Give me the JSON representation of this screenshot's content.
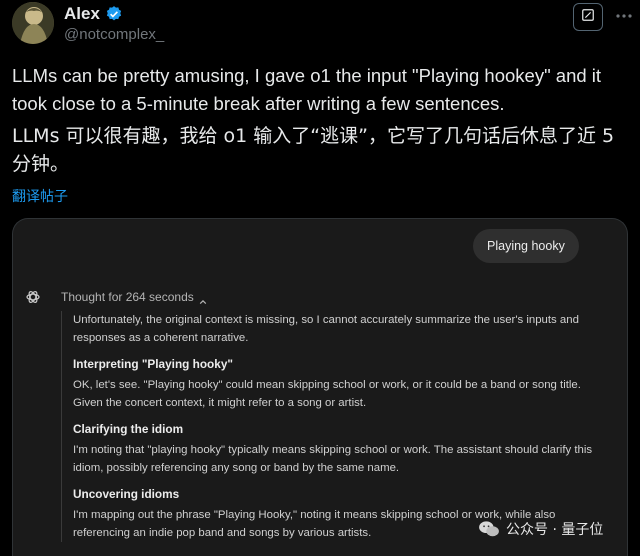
{
  "author": {
    "name": "Alex",
    "handle": "@notcomplex_",
    "verified": true
  },
  "tweet": {
    "text_en": "LLMs can be pretty amusing, I gave o1 the input \"Playing hookey\" and it took close to a 5-minute break after writing a few sentences.",
    "text_zh": "LLMs 可以很有趣，我给 o1 输入了“逃课”，它写了几句话后休息了近 5 分钟。",
    "translate_link": "翻译帖子"
  },
  "chat": {
    "user_message": "Playing hooky",
    "thought_label": "Thought for 264 seconds",
    "intro": "Unfortunately, the original context is missing, so I cannot accurately summarize the user's inputs and responses as a coherent narrative.",
    "steps": [
      {
        "title": "Interpreting \"Playing hooky\"",
        "body": "OK, let's see. \"Playing hooky\" could mean skipping school or work, or it could be a band or song title. Given the concert context, it might refer to a song or artist."
      },
      {
        "title": "Clarifying the idiom",
        "body": "I'm noting that \"playing hooky\" typically means skipping school or work. The assistant should clarify this idiom, possibly referencing any song or band by the same name."
      },
      {
        "title": "Uncovering idioms",
        "body": "I'm mapping out the phrase \"Playing Hooky,\" noting it means skipping school or work, while also referencing an indie pop band and songs by various artists."
      }
    ]
  },
  "watermark": {
    "text": "公众号 · 量子位"
  },
  "icons": {
    "verified": "verified-badge-icon",
    "grok": "grok-icon",
    "more": "more-icon",
    "gpt": "openai-logo-icon",
    "caret": "chevron-up-icon",
    "wechat": "wechat-icon"
  },
  "colors": {
    "background": "#000000",
    "text": "#e7e9ea",
    "muted": "#71767b",
    "link": "#1d9bf0",
    "card": "#1a1a1a"
  }
}
